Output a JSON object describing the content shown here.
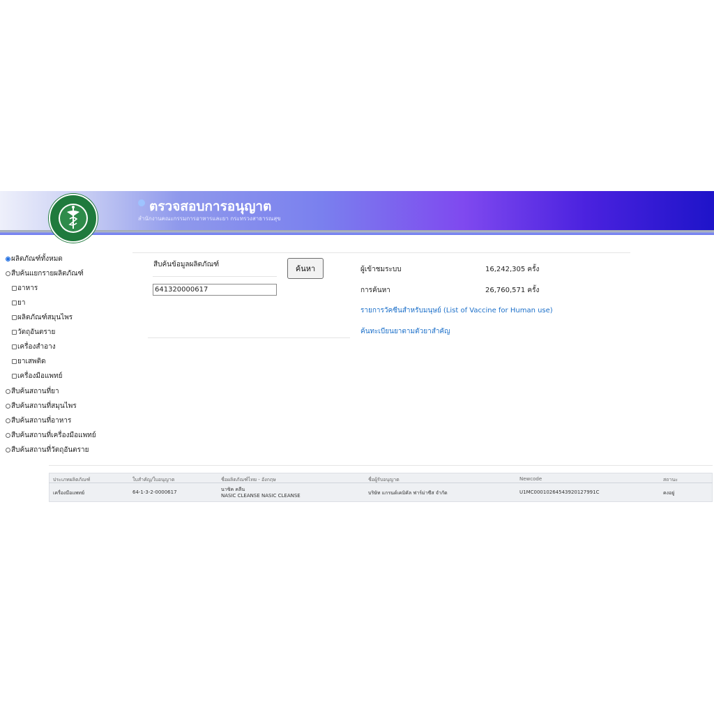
{
  "header": {
    "title": "ตรวจสอบการอนุญาต",
    "subtitle": "สำนักงานคณะกรรมการอาหารและยา กระทรวงสาธารณสุข",
    "brand_color": "#4b22df"
  },
  "sidebar": {
    "items": [
      {
        "label": "ผลิตภัณฑ์ทั้งหมด",
        "type": "radio",
        "checked": true
      },
      {
        "label": "สืบค้นแยกรายผลิตภัณฑ์",
        "type": "radio",
        "checked": false
      },
      {
        "label": "อาหาร",
        "type": "checkbox",
        "checked": false
      },
      {
        "label": "ยา",
        "type": "checkbox",
        "checked": false
      },
      {
        "label": "ผลิตภัณฑ์สมุนไพร",
        "type": "checkbox",
        "checked": false
      },
      {
        "label": "วัตถุอันตราย",
        "type": "checkbox",
        "checked": false
      },
      {
        "label": "เครื่องสำอาง",
        "type": "checkbox",
        "checked": false
      },
      {
        "label": "ยาเสพติด",
        "type": "checkbox",
        "checked": false
      },
      {
        "label": "เครื่องมือแพทย์",
        "type": "checkbox",
        "checked": false
      },
      {
        "label": "สืบค้นสถานที่ยา",
        "type": "radio",
        "checked": false
      },
      {
        "label": "สืบค้นสถานที่สมุนไพร",
        "type": "radio",
        "checked": false
      },
      {
        "label": "สืบค้นสถานที่อาหาร",
        "type": "radio",
        "checked": false
      },
      {
        "label": "สืบค้นสถานที่เครื่องมือแพทย์",
        "type": "radio",
        "checked": false
      },
      {
        "label": "สืบค้นสถานที่วัตถุอันตราย",
        "type": "radio",
        "checked": false
      }
    ]
  },
  "search": {
    "label": "สืบค้นข้อมูลผลิตภัณฑ์",
    "value": "641320000617",
    "button_label": "ค้นหา"
  },
  "stats": {
    "visitors_label": "ผู้เข้าชมระบบ",
    "visitors_value": "16,242,305 ครั้ง",
    "searches_label": "การค้นหา",
    "searches_value": "26,760,571 ครั้ง"
  },
  "links": {
    "vaccine": "รายการวัคซีนสำหรับมนุษย์ (List of Vaccine for Human use)",
    "essential_drugs": "ค้นทะเบียนยาตามตัวยาสำคัญ"
  },
  "results": {
    "headers": [
      "ประเภทผลิตภัณฑ์",
      "ใบสำคัญ/ใบอนุญาต",
      "ชื่อผลิตภัณฑ์ไทย - อังกฤษ",
      "ชื่อผู้รับอนุญาต",
      "Newcode",
      "สถานะ"
    ],
    "rows": [
      {
        "type": "เครื่องมือแพทย์",
        "license": "64-1-3-2-0000617",
        "name_th": "นาซิค คลีน",
        "name_en": "NASIC CLEANSE NASIC CLEANSE",
        "licensee": "บริษัท แกรนด์เคมิคัล ฟาร์ม่าซีส จำกัด",
        "newcode": "U1MC00010264543920127991C",
        "status": "คงอยู่"
      }
    ]
  }
}
